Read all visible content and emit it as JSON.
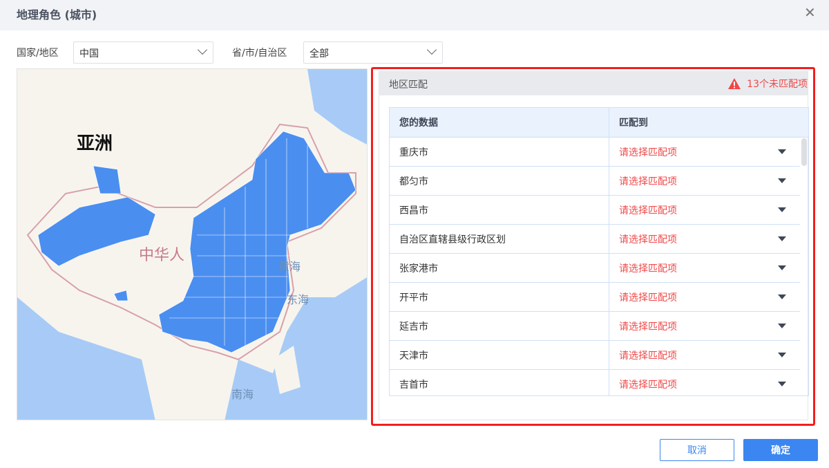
{
  "dialog": {
    "title": "地理角色 (城市)",
    "close_icon": "close-icon"
  },
  "filters": {
    "country_label": "国家/地区",
    "country_value": "中国",
    "province_label": "省/市/自治区",
    "province_value": "全部"
  },
  "map": {
    "labels": {
      "asia": "亚洲",
      "china": "中华人",
      "yellow_sea": "黄海",
      "east_sea": "东海",
      "south_sea": "南海"
    },
    "fill_color": "#4a8ef0"
  },
  "panel": {
    "title": "地区匹配",
    "warning": "13个未匹配项",
    "warning_color": "#f04848"
  },
  "table": {
    "headers": [
      "您的数据",
      "匹配到"
    ],
    "rows": [
      {
        "data": "重庆市",
        "match": "请选择匹配项"
      },
      {
        "data": "都匀市",
        "match": "请选择匹配项"
      },
      {
        "data": "西昌市",
        "match": "请选择匹配项"
      },
      {
        "data": "自治区直辖县级行政区划",
        "match": "请选择匹配项"
      },
      {
        "data": "张家港市",
        "match": "请选择匹配项"
      },
      {
        "data": "开平市",
        "match": "请选择匹配项"
      },
      {
        "data": "延吉市",
        "match": "请选择匹配项"
      },
      {
        "data": "天津市",
        "match": "请选择匹配项"
      },
      {
        "data": "吉首市",
        "match": "请选择匹配项"
      }
    ]
  },
  "buttons": {
    "cancel": "取消",
    "ok": "确定"
  }
}
